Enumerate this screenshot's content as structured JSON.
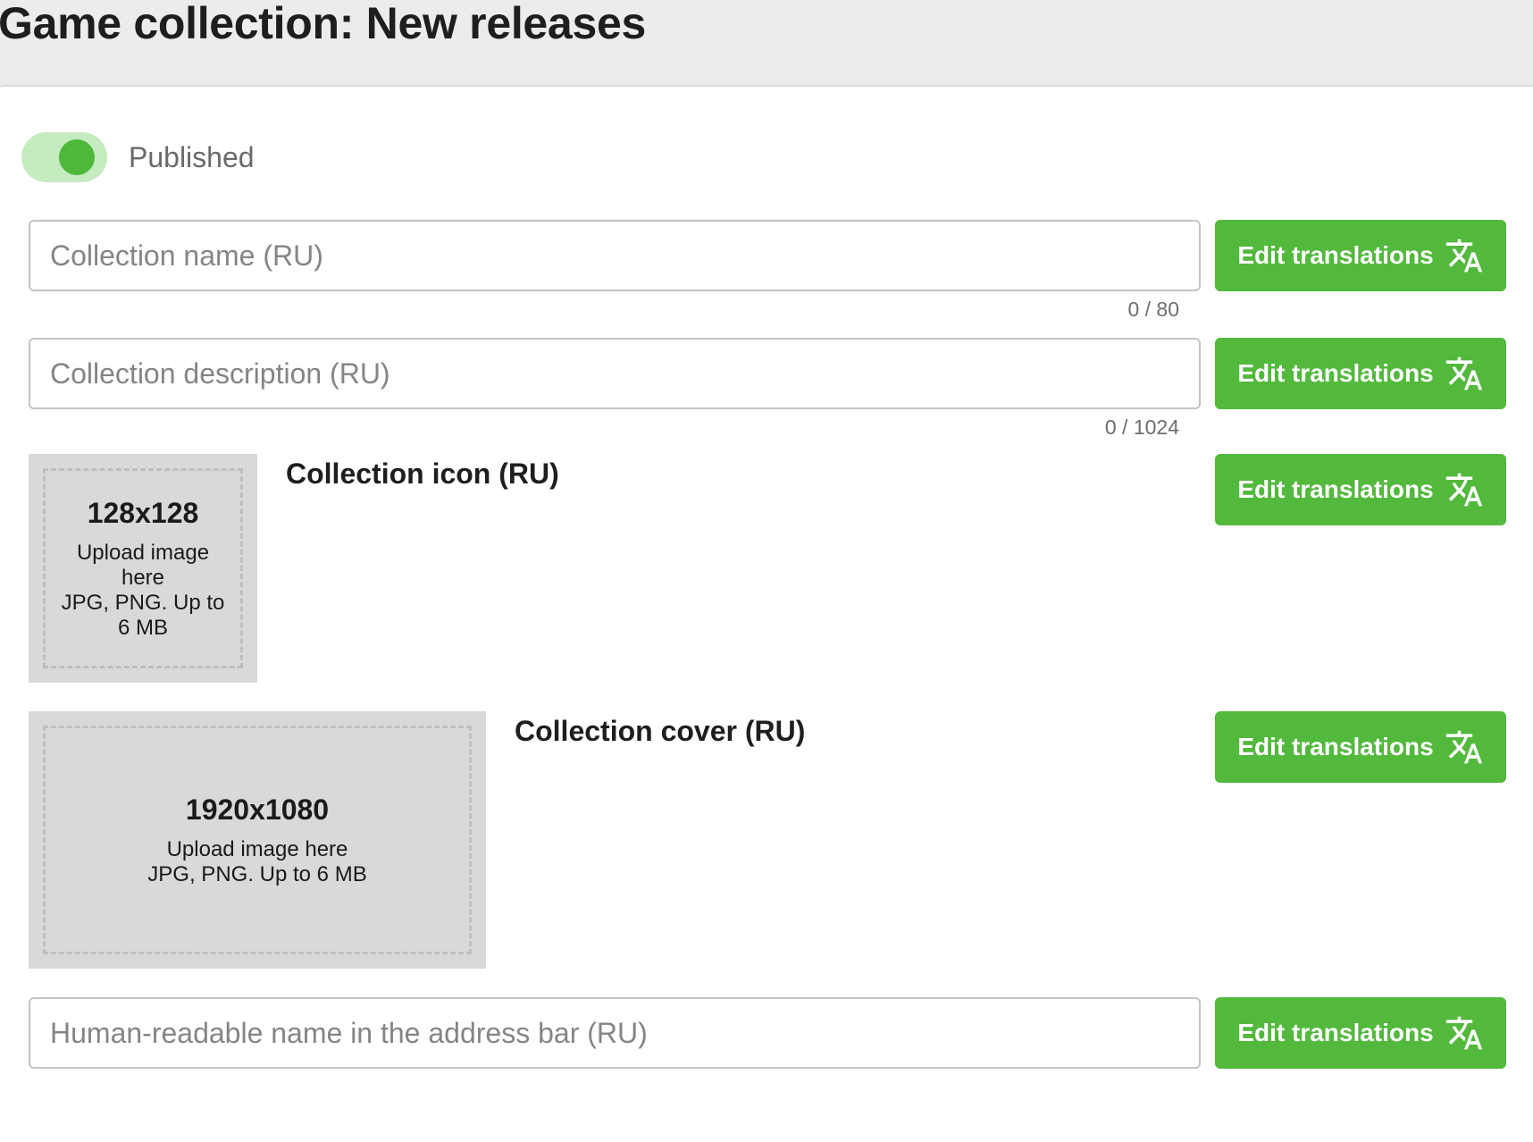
{
  "header": {
    "title": "Game collection: New releases"
  },
  "published": {
    "label": "Published",
    "enabled": true
  },
  "fields": {
    "name": {
      "placeholder": "Collection name (RU)",
      "value": "",
      "counter": "0 / 80"
    },
    "description": {
      "placeholder": "Collection description (RU)",
      "value": "",
      "counter": "0 / 1024"
    },
    "slug": {
      "placeholder": "Human-readable name in the address bar (RU)",
      "value": ""
    }
  },
  "icon": {
    "label": "Collection icon (RU)",
    "size": "128x128",
    "upload_line": "Upload image here",
    "formats_line": "JPG, PNG. Up to 6 MB"
  },
  "cover": {
    "label": "Collection cover (RU)",
    "size": "1920x1080",
    "upload_line": "Upload image here",
    "formats_line": "JPG, PNG. Up to 6 MB"
  },
  "buttons": {
    "edit_translations_label": "Edit translations",
    "icon": "translate-icon"
  },
  "colors": {
    "accent": "#52b93c",
    "toggle_track": "#c6ebc0",
    "toggle_knob": "#4db83a",
    "upload_bg": "#d9d9d9"
  }
}
